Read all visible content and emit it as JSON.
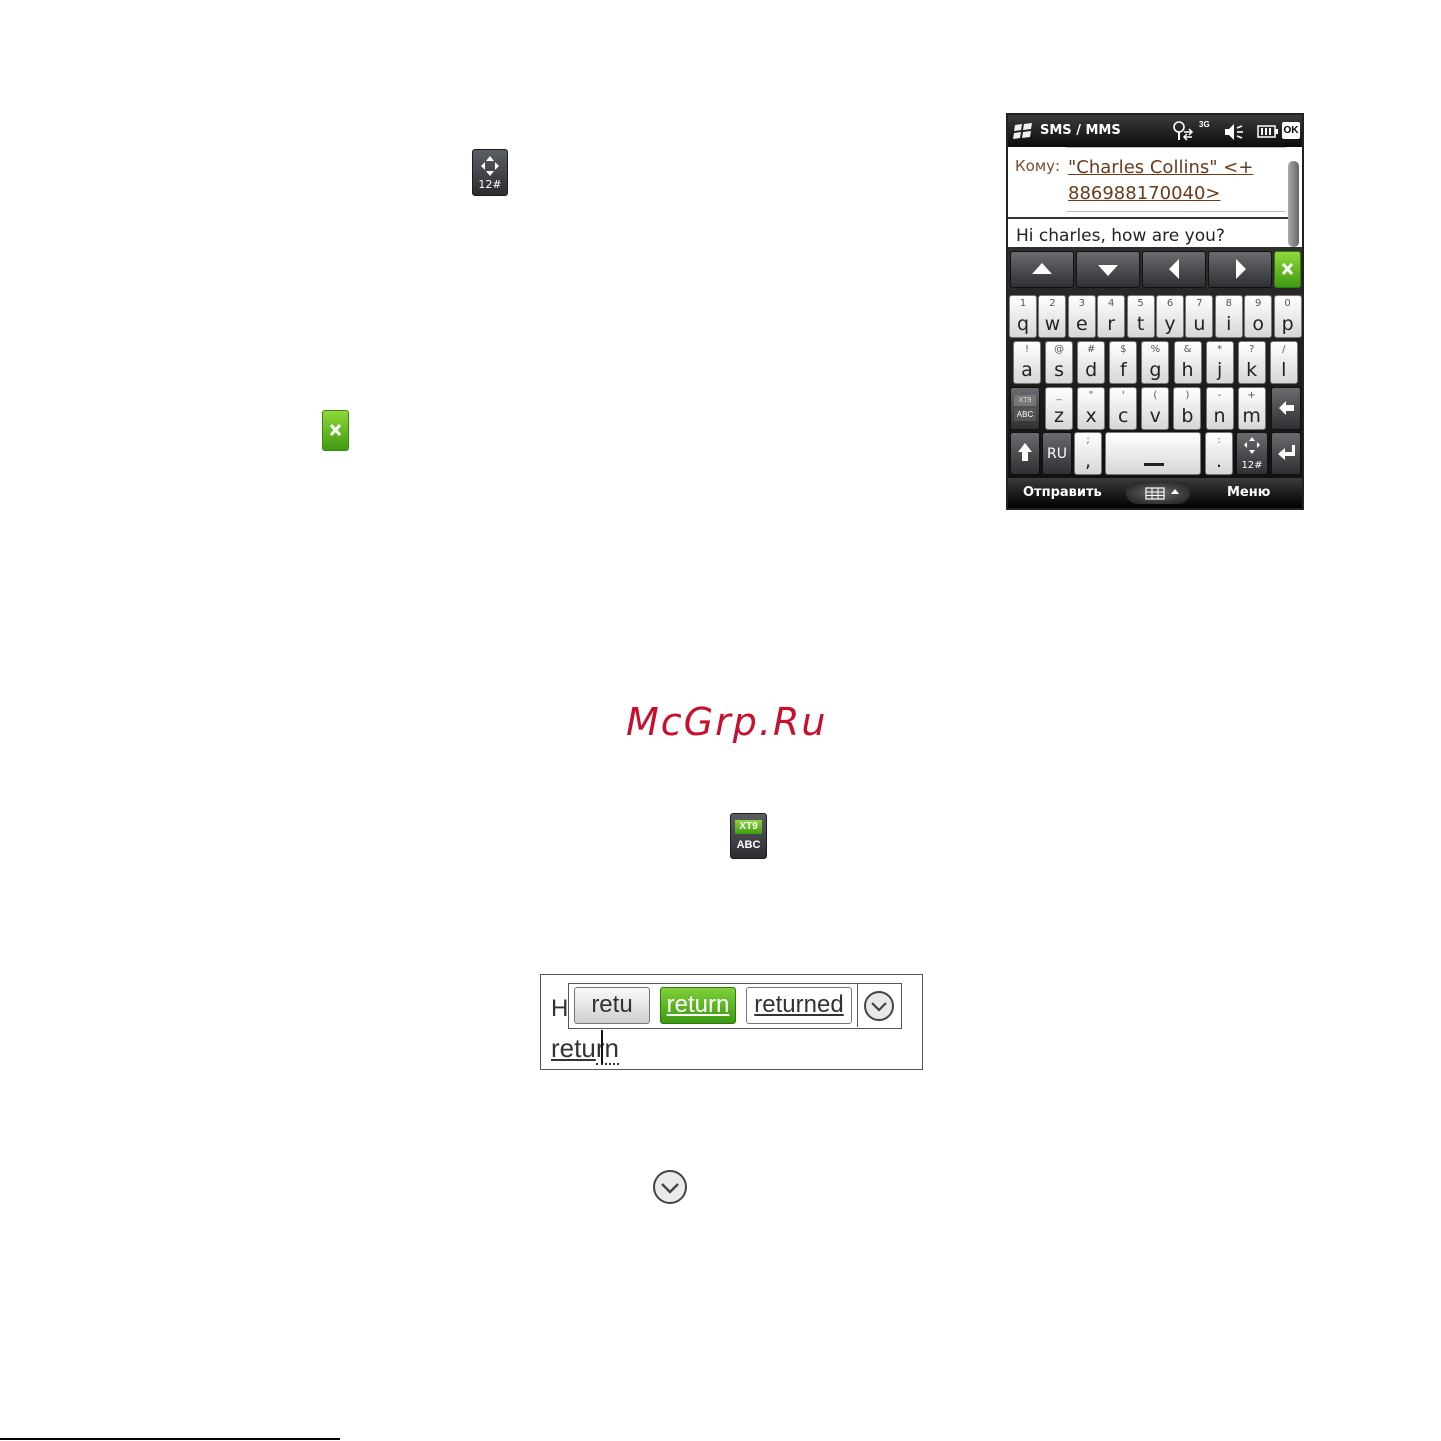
{
  "icons": {
    "numeric_key": {
      "label": "12#"
    },
    "xt9_key": {
      "top": "XT9",
      "bottom": "ABC"
    }
  },
  "phone": {
    "status": {
      "title": "SMS / MMS",
      "signal": "3G",
      "ok": "OK"
    },
    "to_label": "Кому:",
    "recipient_line1": "\"Charles Collins\" <+",
    "recipient_line2": "886988170040>",
    "message": "Hi charles,  how are you?",
    "keyboard": {
      "row1": [
        {
          "sub": "1",
          "main": "q"
        },
        {
          "sub": "2",
          "main": "w"
        },
        {
          "sub": "3",
          "main": "e"
        },
        {
          "sub": "4",
          "main": "r"
        },
        {
          "sub": "5",
          "main": "t"
        },
        {
          "sub": "6",
          "main": "y"
        },
        {
          "sub": "7",
          "main": "u"
        },
        {
          "sub": "8",
          "main": "i"
        },
        {
          "sub": "9",
          "main": "o"
        },
        {
          "sub": "0",
          "main": "p"
        }
      ],
      "row2": [
        {
          "sub": "!",
          "main": "a"
        },
        {
          "sub": "@",
          "main": "s"
        },
        {
          "sub": "#",
          "main": "d"
        },
        {
          "sub": "$",
          "main": "f"
        },
        {
          "sub": "%",
          "main": "g"
        },
        {
          "sub": "&",
          "main": "h"
        },
        {
          "sub": "*",
          "main": "j"
        },
        {
          "sub": "?",
          "main": "k"
        },
        {
          "sub": "/",
          "main": "l"
        }
      ],
      "row3": [
        {
          "sub": "_",
          "main": "z"
        },
        {
          "sub": "\"",
          "main": "x"
        },
        {
          "sub": "'",
          "main": "c"
        },
        {
          "sub": "(",
          "main": "v"
        },
        {
          "sub": ")",
          "main": "b"
        },
        {
          "sub": "-",
          "main": "n"
        },
        {
          "sub": "+",
          "main": "m"
        }
      ],
      "xt9_top": "XT9",
      "xt9_bottom": "ABC",
      "lang": "RU",
      "comma_sub": ";",
      "comma_main": ",",
      "period_sub": ":",
      "period_main": ".",
      "num_label": "12#"
    },
    "softkeys": {
      "left": "Отправить",
      "right": "Меню"
    }
  },
  "watermark": "McGrp.Ru",
  "candidates": {
    "typed_prefix": "H",
    "items": [
      "retu",
      "return",
      "returned"
    ],
    "selected_index": 1,
    "typed_word_start": "retu",
    "typed_word_end": "rn"
  }
}
